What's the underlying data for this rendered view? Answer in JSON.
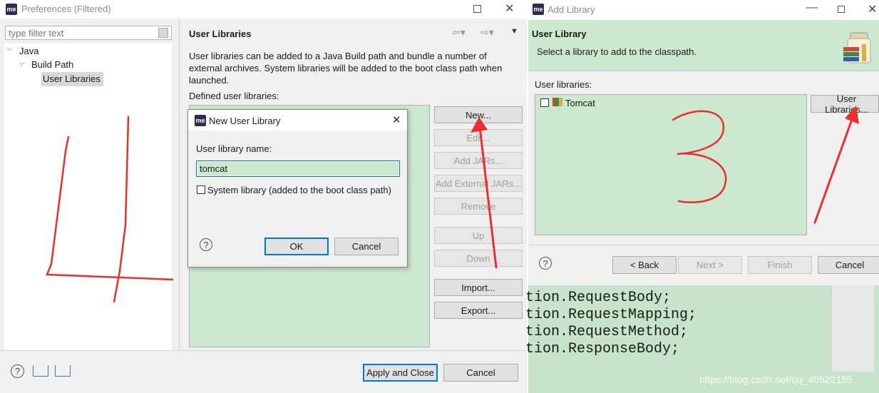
{
  "preferences": {
    "title": "Preferences (Filtered)",
    "filter_placeholder": "type filter text",
    "tree": {
      "java": "Java",
      "build_path": "Build Path",
      "user_libraries": "User Libraries"
    },
    "page_title": "User Libraries",
    "description": "User libraries can be added to a Java Build path and bundle a number of external archives. System libraries will be added to the boot class path when launched.",
    "defined_label": "Defined user libraries:",
    "buttons": {
      "new": "New...",
      "edit": "Edit...",
      "add_jars": "Add JARs...",
      "add_external_jars": "Add External JARs...",
      "remove": "Remove",
      "up": "Up",
      "down": "Down",
      "import": "Import...",
      "export": "Export...",
      "apply_close": "Apply and Close",
      "cancel": "Cancel"
    }
  },
  "new_user_library": {
    "title": "New User Library",
    "name_label": "User library name:",
    "name_value": "tomcat",
    "system_checkbox": "System library (added to the boot class path)",
    "ok": "OK",
    "cancel": "Cancel"
  },
  "add_library": {
    "title": "Add Library",
    "heading": "User Library",
    "subtitle": "Select a library to add to the classpath.",
    "libraries_label": "User libraries:",
    "items": [
      "Tomcat"
    ],
    "user_libraries_button": "User Libraries...",
    "back": "< Back",
    "next": "Next >",
    "finish": "Finish",
    "cancel": "Cancel"
  },
  "editor_lines": [
    "tion.RequestBody;",
    "tion.RequestMapping;",
    "tion.RequestMethod;",
    "tion.ResponseBody;"
  ],
  "watermark": "https://blog.csdn.net/qq_40522155",
  "annotations": {
    "left_number": "4",
    "right_number": "3"
  },
  "colors": {
    "list_bg": "#cce8cf",
    "accent": "#0078d7",
    "annotation": "#e8302f"
  }
}
